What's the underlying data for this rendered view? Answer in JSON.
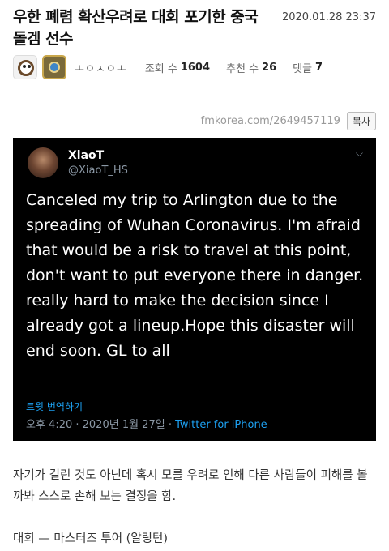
{
  "post": {
    "title": "우한 폐렴 확산우려로 대회 포기한 중국 돌겜 선수",
    "datetime": "2020.01.28 23:37",
    "author": "ㅗㅇㅅㅇㅗ",
    "views_label": "조회 수",
    "views": "1604",
    "recommend_label": "추천 수",
    "recommend": "26",
    "comments_label": "댓글",
    "comments": "7",
    "source_url": "fmkorea.com/2649457119",
    "copy_label": "복사"
  },
  "tweet": {
    "name": "XiaoT",
    "handle": "@XiaoT_HS",
    "text": "Canceled my trip to Arlington due to the spreading of Wuhan Coronavirus. I'm afraid that would be a risk to travel at this point, don't want to put everyone there in danger.\nreally hard to make the decision since I already got a lineup.Hope this disaster will end soon. GL to all",
    "translate": "트윗 번역하기",
    "timestamp": "오후 4:20 · 2020년 1월 27일 · ",
    "source": "Twitter for iPhone"
  },
  "article": {
    "paragraph1": "자기가 걸린 것도 아닌데 혹시 모를 우려로 인해 다른 사람들이 피해를 볼까봐 스스로 손해 보는 결정을 함.",
    "paragraph2": "대회 — 마스터즈 투어 (알링턴)"
  }
}
